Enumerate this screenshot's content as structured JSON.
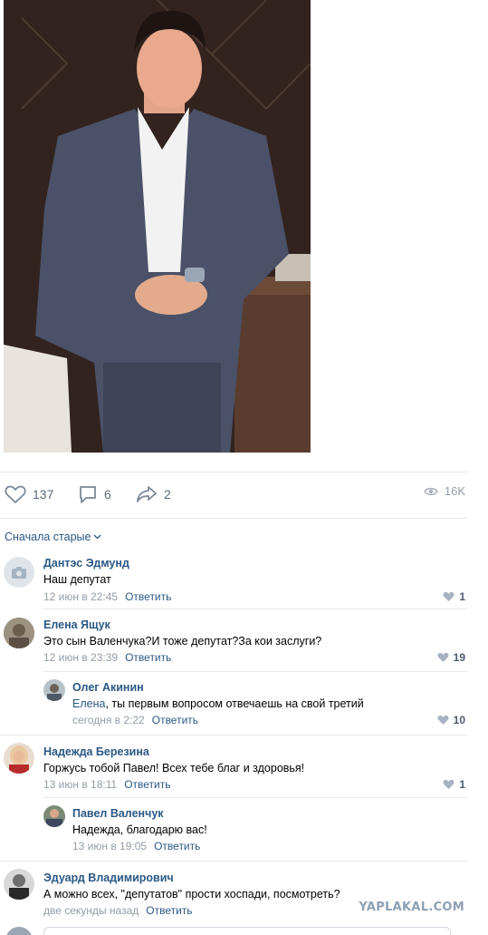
{
  "post": {
    "likes": "137",
    "comments": "6",
    "shares": "2",
    "views": "16K"
  },
  "sort_label": "Сначала старые",
  "reply_label": "Ответить",
  "comments": [
    {
      "author": "Дантэс Эдмунд",
      "text": "Наш депутат",
      "time": "12 июн в 22:45",
      "likes": "1",
      "avatar": "camera-placeholder"
    },
    {
      "author": "Елена Ящук",
      "text": "Это сын Валенчука?И тоже депутат?За кои заслуги?",
      "time": "12 июн в 23:39",
      "likes": "19",
      "avatar": "photo"
    },
    {
      "author": "Олег Акинин",
      "mention": "Елена",
      "text": ", ты первым вопросом отвечаешь на свой третий",
      "time": "сегодня в 2:22",
      "likes": "10",
      "avatar": "photo"
    },
    {
      "author": "Надежда Березина",
      "text": "Горжусь тобой Павел! Всех тебе благ и здоровья!",
      "time": "13 июн в 18:11",
      "likes": "1",
      "avatar": "photo"
    },
    {
      "author": "Павел Валенчук",
      "text": "Надежда, благодарю вас!",
      "time": "13 июн в 19:05",
      "likes": "",
      "avatar": "photo"
    },
    {
      "author": "Эдуард Владимирович",
      "text": "А можно всех, \"депутатов\" прости хоспади, посмотреть?",
      "time": "две секунды назад",
      "likes": "",
      "avatar": "photo"
    }
  ],
  "watermark": "YAPLAKAL.COM",
  "colors": {
    "link": "#2a5885",
    "meta": "#939ca8",
    "separator": "#e7e8ec"
  }
}
